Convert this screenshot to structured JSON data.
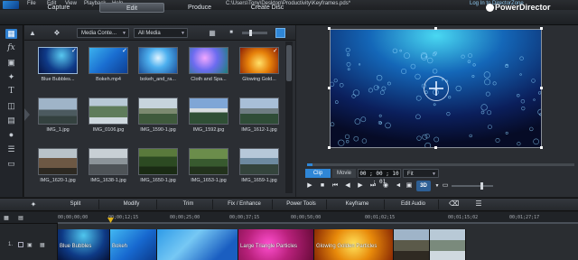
{
  "window": {
    "menu": [
      "File",
      "Edit",
      "View",
      "Playback",
      "Help"
    ],
    "title": "C:\\Users\\Tony\\Desktop\\Productivity\\Keyframes.pds*",
    "directorzone_link": "Log In to DirectorZone"
  },
  "modes": {
    "capture": "Capture",
    "edit": "Edit",
    "produce": "Produce",
    "create_disc": "Create Disc",
    "active": "Edit"
  },
  "brand": {
    "logo_text": "PowerDirector"
  },
  "library": {
    "filter_content": "Media Conte...",
    "filter_type": "All Media",
    "thumbnails": [
      {
        "label": "Blue Bubbles...",
        "checked": true
      },
      {
        "label": "Bokeh.mp4",
        "checked": true
      },
      {
        "label": "bokeh_and_ra...",
        "checked": false
      },
      {
        "label": "Cloth and Spa...",
        "checked": false
      },
      {
        "label": "Glowing Gold...",
        "checked": true
      },
      {
        "label": "IMG_1.jpg",
        "checked": false
      },
      {
        "label": "IMG_0106.jpg",
        "checked": false
      },
      {
        "label": "IMG_1590-1.jpg",
        "checked": false
      },
      {
        "label": "IMG_1592.jpg",
        "checked": false
      },
      {
        "label": "IMG_1612-1.jpg",
        "checked": false
      },
      {
        "label": "IMG_1620-1.jpg",
        "checked": false
      },
      {
        "label": "IMG_1638-1.jpg",
        "checked": false
      },
      {
        "label": "IMG_1650-1.jpg",
        "checked": false
      },
      {
        "label": "IMG_1653-1.jpg",
        "checked": false
      },
      {
        "label": "IMG_1659-1.jpg",
        "checked": false
      }
    ]
  },
  "preview": {
    "tab_clip": "Clip",
    "tab_movie": "Movie",
    "timecode": "00 ; 00 ; 10 ; 01",
    "fit": "Fit",
    "three_d": "3D",
    "progress": 0.02
  },
  "edit_toolbar": {
    "split": "Split",
    "modify": "Modify",
    "trim": "Trim",
    "fix_enhance": "Fix / Enhance",
    "power_tools": "Power Tools",
    "keyframe": "Keyframe",
    "edit_audio": "Edit Audio"
  },
  "timeline": {
    "ruler_labels": [
      "00;00;00;00",
      "00;00;12;15",
      "00;00;25;00",
      "00;00;37;15",
      "00;00;50;00",
      "00;01;02;15",
      "00;01;15;02",
      "00;01;27;17"
    ],
    "track_number": "1.",
    "clips": [
      {
        "label": "Blue Bubbles"
      },
      {
        "label": "Bokeh"
      },
      {
        "label": ""
      },
      {
        "label": "Large Triangle Particles"
      },
      {
        "label": "Glowing Golden Particles"
      },
      {
        "label": ""
      },
      {
        "label": ""
      }
    ]
  },
  "colors": {
    "accent": "#2f86d6",
    "playhead": "#e0b21a",
    "background": "#1b1d20"
  }
}
